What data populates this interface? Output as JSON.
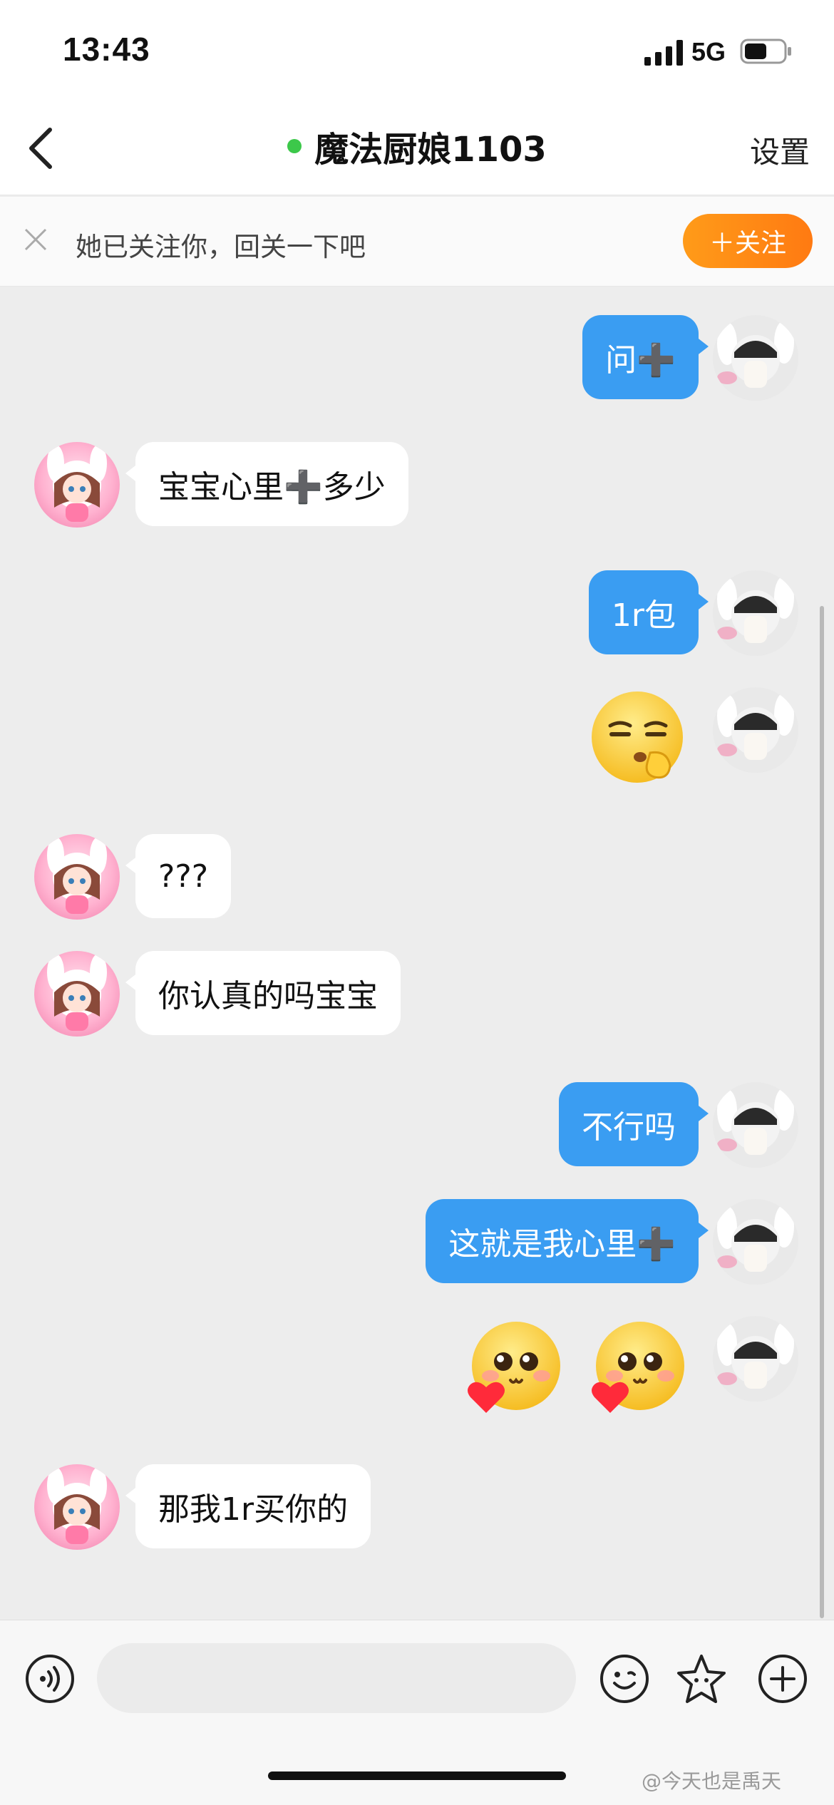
{
  "status_bar": {
    "time": "13:43",
    "network": "5G"
  },
  "header": {
    "title": "魔法厨娘1103",
    "settings_label": "设置"
  },
  "follow_banner": {
    "text": "她已关注你，回关一下吧",
    "button_label": "＋关注"
  },
  "messages": [
    {
      "from": "me",
      "text": "问➕"
    },
    {
      "from": "her",
      "text": "宝宝心里➕多少"
    },
    {
      "from": "me",
      "text": "1r包"
    },
    {
      "from": "me",
      "emoji": "shush-emoji"
    },
    {
      "from": "her",
      "text": "???"
    },
    {
      "from": "her",
      "text": "你认真的吗宝宝"
    },
    {
      "from": "me",
      "text": "不行吗"
    },
    {
      "from": "me",
      "text": "这就是我心里➕"
    },
    {
      "from": "me",
      "emoji": [
        "heart-blush-emoji",
        "heart-blush-emoji"
      ]
    },
    {
      "from": "her",
      "text": "那我1r买你的"
    }
  ],
  "input": {
    "placeholder": ""
  },
  "icons": {
    "back": "chevron-left-icon",
    "voice": "voice-icon",
    "emoji": "smiley-icon",
    "sticker": "star-sticker-icon",
    "more": "plus-icon"
  },
  "colors": {
    "my_bubble": "#3a9df2",
    "her_bubble": "#ffffff",
    "background": "#ededed",
    "follow_button": "#ff8a15",
    "online_dot": "#3cc84a"
  },
  "watermark": "@今天也是禹天"
}
